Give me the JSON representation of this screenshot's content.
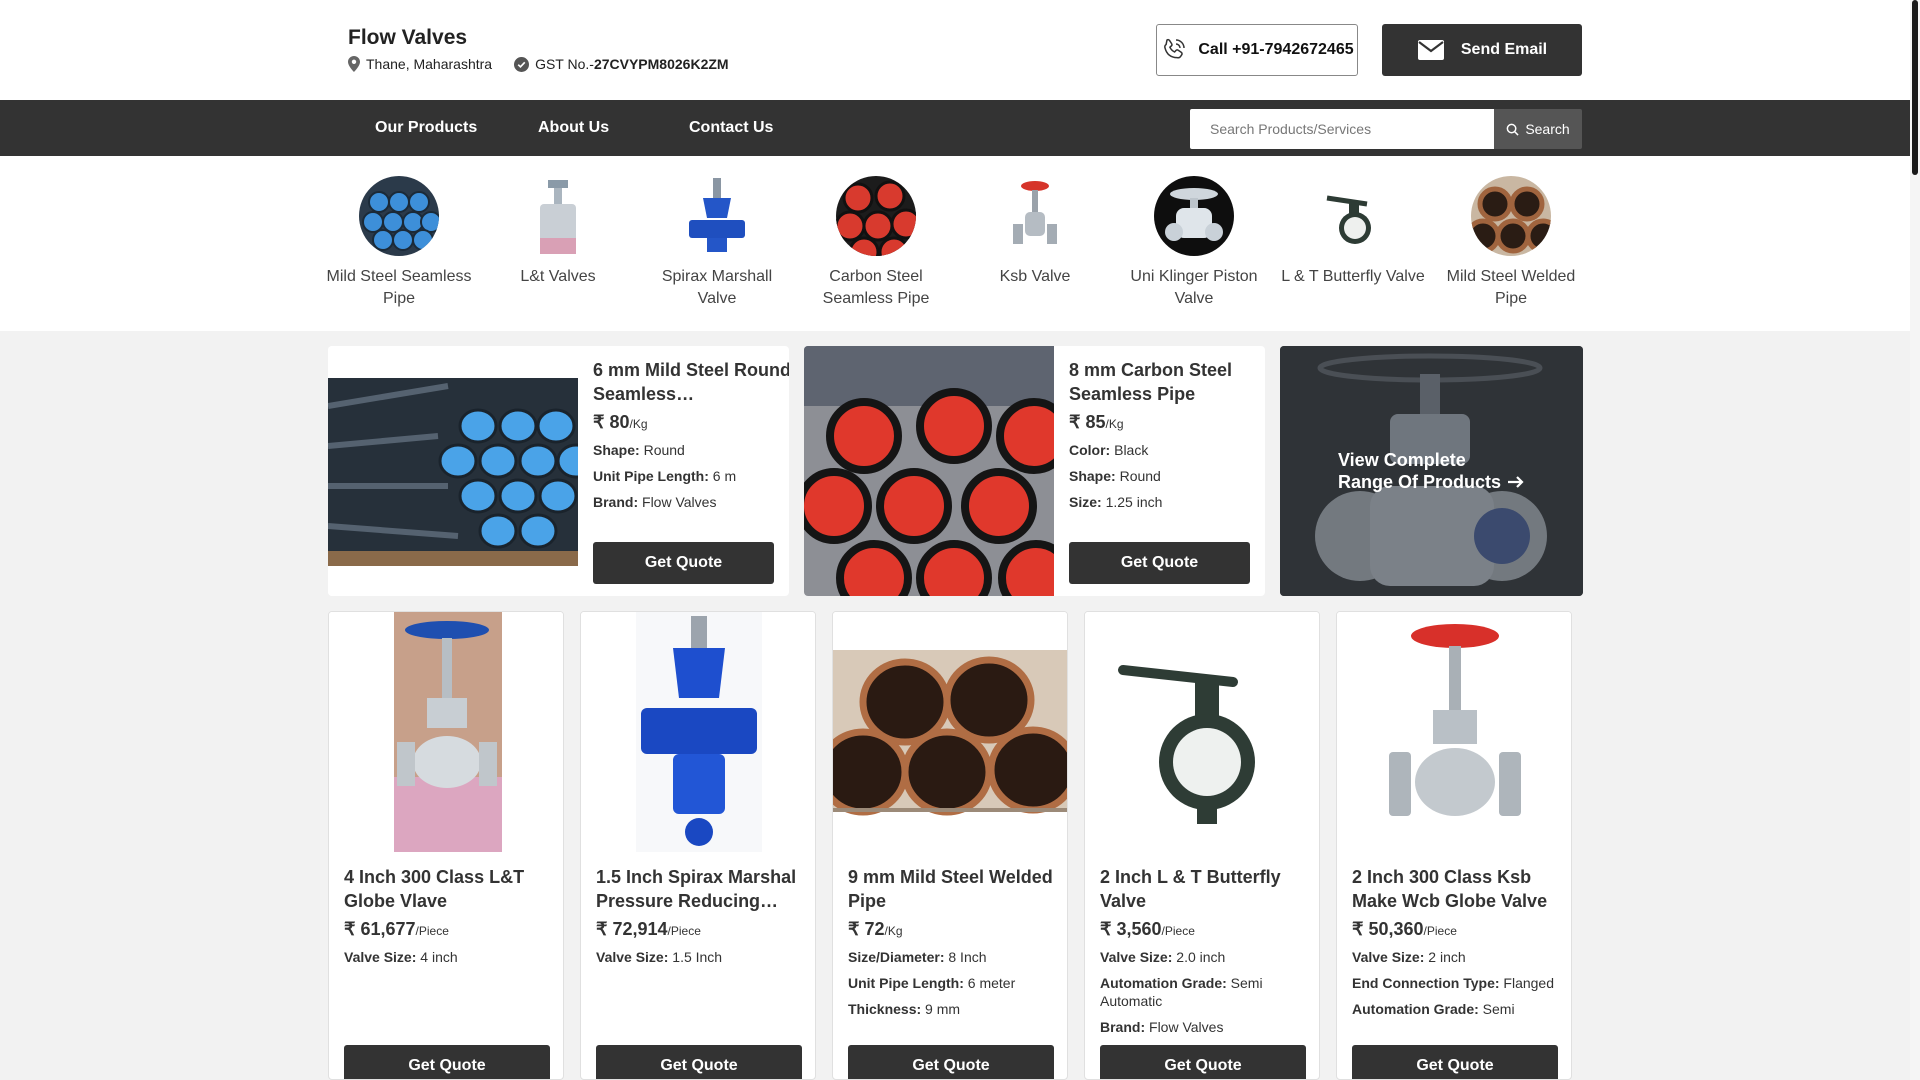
{
  "header": {
    "company_name": "Flow Valves",
    "location": "Thane, Maharashtra",
    "gst_label": "GST No.-",
    "gst_number": "27CVYPM8026K2ZM",
    "call_label": "Call +91-7942672465",
    "email_label": "Send Email"
  },
  "nav": {
    "items": [
      "Our Products",
      "About Us",
      "Contact Us"
    ],
    "search_placeholder": "Search Products/Services",
    "search_button": "Search"
  },
  "categories": [
    {
      "label": "Mild Steel Seamless Pipe",
      "icon": "blue-pipes"
    },
    {
      "label": "L&t Valves",
      "icon": "valve"
    },
    {
      "label": "Spirax Marshall Valve",
      "icon": "blue-valve"
    },
    {
      "label": "Carbon Steel Seamless Pipe",
      "icon": "red-pipes"
    },
    {
      "label": "Ksb Valve",
      "icon": "globe-valve"
    },
    {
      "label": "Uni Klinger Piston Valve",
      "icon": "piston-valve"
    },
    {
      "label": "L & T Butterfly Valve",
      "icon": "butterfly-valve"
    },
    {
      "label": "Mild Steel Welded Pipe",
      "icon": "rusty-pipes"
    }
  ],
  "featured": [
    {
      "title": "6 mm Mild Steel Round Seamless…",
      "price": "80",
      "unit": "/Kg",
      "specs": [
        {
          "k": "Shape:",
          "v": "Round"
        },
        {
          "k": "Unit Pipe Length:",
          "v": "6 m"
        },
        {
          "k": "Brand:",
          "v": "Flow Valves"
        }
      ],
      "cta": "Get Quote"
    },
    {
      "title": "8 mm Carbon Steel Seamless Pipe",
      "price": "85",
      "unit": "/Kg",
      "specs": [
        {
          "k": "Color:",
          "v": "Black"
        },
        {
          "k": "Shape:",
          "v": "Round"
        },
        {
          "k": "Size:",
          "v": "1.25 inch"
        }
      ],
      "cta": "Get Quote"
    }
  ],
  "range_cta": {
    "line1": "View Complete",
    "line2": "Range Of Products"
  },
  "products": [
    {
      "title": "4 Inch 300 Class L&T Globe Vlave",
      "price": "61,677",
      "unit": "/Piece",
      "specs": [
        {
          "k": "Valve Size:",
          "v": "4 inch"
        }
      ],
      "cta": "Get Quote"
    },
    {
      "title": "1.5 Inch Spirax Marshal Pressure Reducing…",
      "price": "72,914",
      "unit": "/Piece",
      "specs": [
        {
          "k": "Valve Size:",
          "v": "1.5 Inch"
        }
      ],
      "cta": "Get Quote"
    },
    {
      "title": "9 mm Mild Steel Welded Pipe",
      "price": "72",
      "unit": "/Kg",
      "specs": [
        {
          "k": "Size/Diameter:",
          "v": "8 Inch"
        },
        {
          "k": "Unit Pipe Length:",
          "v": "6 meter"
        },
        {
          "k": "Thickness:",
          "v": "9 mm"
        }
      ],
      "cta": "Get Quote"
    },
    {
      "title": "2 Inch L & T Butterfly Valve",
      "price": "3,560",
      "unit": "/Piece",
      "specs": [
        {
          "k": "Valve Size:",
          "v": "2.0 inch"
        },
        {
          "k": "Automation Grade:",
          "v": "Semi Automatic"
        },
        {
          "k": "Brand:",
          "v": "Flow Valves"
        }
      ],
      "cta": "Get Quote"
    },
    {
      "title": "2 Inch 300 Class Ksb Make Wcb Globe Valve",
      "price": "50,360",
      "unit": "/Piece",
      "specs": [
        {
          "k": "Valve Size:",
          "v": "2 inch"
        },
        {
          "k": "End Connection Type:",
          "v": "Flanged"
        },
        {
          "k": "Automation Grade:",
          "v": "Semi"
        }
      ],
      "cta": "Get Quote"
    }
  ],
  "currency_symbol": "₹"
}
